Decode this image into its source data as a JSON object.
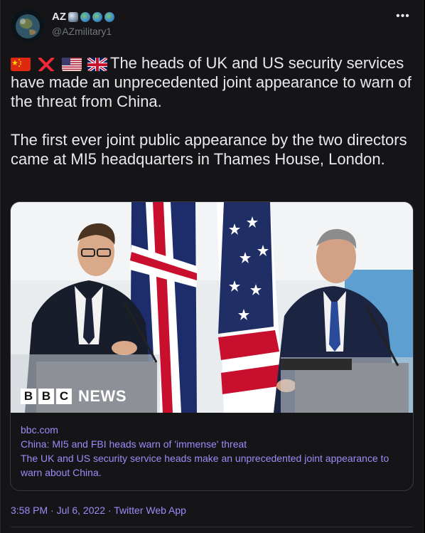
{
  "user": {
    "display_name": "AZ",
    "name_emojis": [
      "satellite-emoji",
      "globe-emoji",
      "globe-emoji",
      "globe-emoji"
    ],
    "handle": "@AZmilitary1"
  },
  "more_label": "•••",
  "tweet": {
    "flags": [
      "china-flag",
      "cross-mark-emoji",
      "us-flag",
      "uk-flag"
    ],
    "paragraph1": "The heads of UK and US security services have made an unprecedented joint appearance to warn of the threat from China.",
    "paragraph2": "The first ever joint public appearance by the two directors came at MI5 headquarters in Thames House, London."
  },
  "card": {
    "image_logo": {
      "letters": [
        "B",
        "B",
        "C"
      ],
      "word": "NEWS"
    },
    "domain": "bbc.com",
    "title": "China: MI5 and FBI heads warn of 'immense' threat",
    "description": "The UK and US security service heads make an unprecedented joint appearance to warn about China."
  },
  "meta": {
    "text": "3:58 PM · Jul 6, 2022 · Twitter Web App"
  },
  "colors": {
    "background": "#151518",
    "text": "#e7e9ea",
    "muted": "#71767b",
    "link": "#9b8cf7"
  }
}
